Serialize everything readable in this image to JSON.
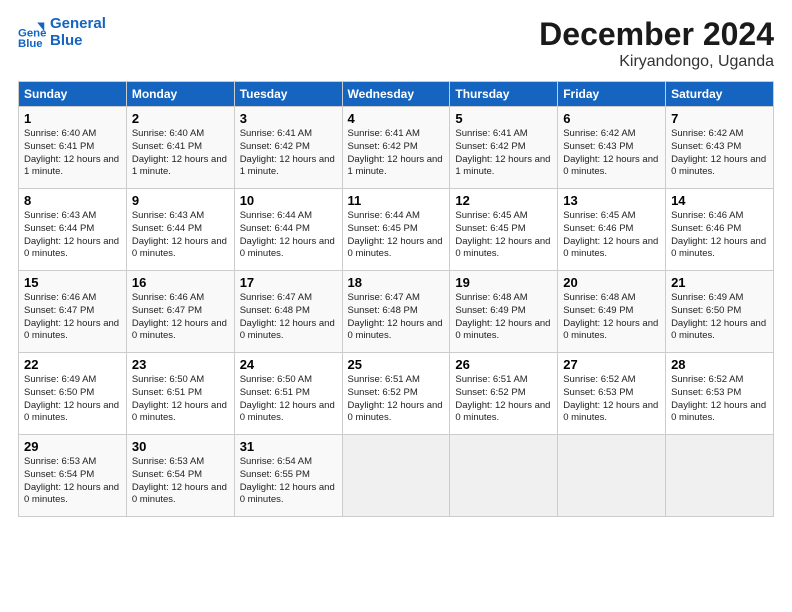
{
  "header": {
    "logo_line1": "General",
    "logo_line2": "Blue",
    "month": "December 2024",
    "location": "Kiryandongo, Uganda"
  },
  "days_of_week": [
    "Sunday",
    "Monday",
    "Tuesday",
    "Wednesday",
    "Thursday",
    "Friday",
    "Saturday"
  ],
  "weeks": [
    [
      {
        "day": "1",
        "sunrise": "6:40 AM",
        "sunset": "6:41 PM",
        "daylight": "12 hours and 1 minute."
      },
      {
        "day": "2",
        "sunrise": "6:40 AM",
        "sunset": "6:41 PM",
        "daylight": "12 hours and 1 minute."
      },
      {
        "day": "3",
        "sunrise": "6:41 AM",
        "sunset": "6:42 PM",
        "daylight": "12 hours and 1 minute."
      },
      {
        "day": "4",
        "sunrise": "6:41 AM",
        "sunset": "6:42 PM",
        "daylight": "12 hours and 1 minute."
      },
      {
        "day": "5",
        "sunrise": "6:41 AM",
        "sunset": "6:42 PM",
        "daylight": "12 hours and 1 minute."
      },
      {
        "day": "6",
        "sunrise": "6:42 AM",
        "sunset": "6:43 PM",
        "daylight": "12 hours and 0 minutes."
      },
      {
        "day": "7",
        "sunrise": "6:42 AM",
        "sunset": "6:43 PM",
        "daylight": "12 hours and 0 minutes."
      }
    ],
    [
      {
        "day": "8",
        "sunrise": "6:43 AM",
        "sunset": "6:44 PM",
        "daylight": "12 hours and 0 minutes."
      },
      {
        "day": "9",
        "sunrise": "6:43 AM",
        "sunset": "6:44 PM",
        "daylight": "12 hours and 0 minutes."
      },
      {
        "day": "10",
        "sunrise": "6:44 AM",
        "sunset": "6:44 PM",
        "daylight": "12 hours and 0 minutes."
      },
      {
        "day": "11",
        "sunrise": "6:44 AM",
        "sunset": "6:45 PM",
        "daylight": "12 hours and 0 minutes."
      },
      {
        "day": "12",
        "sunrise": "6:45 AM",
        "sunset": "6:45 PM",
        "daylight": "12 hours and 0 minutes."
      },
      {
        "day": "13",
        "sunrise": "6:45 AM",
        "sunset": "6:46 PM",
        "daylight": "12 hours and 0 minutes."
      },
      {
        "day": "14",
        "sunrise": "6:46 AM",
        "sunset": "6:46 PM",
        "daylight": "12 hours and 0 minutes."
      }
    ],
    [
      {
        "day": "15",
        "sunrise": "6:46 AM",
        "sunset": "6:47 PM",
        "daylight": "12 hours and 0 minutes."
      },
      {
        "day": "16",
        "sunrise": "6:46 AM",
        "sunset": "6:47 PM",
        "daylight": "12 hours and 0 minutes."
      },
      {
        "day": "17",
        "sunrise": "6:47 AM",
        "sunset": "6:48 PM",
        "daylight": "12 hours and 0 minutes."
      },
      {
        "day": "18",
        "sunrise": "6:47 AM",
        "sunset": "6:48 PM",
        "daylight": "12 hours and 0 minutes."
      },
      {
        "day": "19",
        "sunrise": "6:48 AM",
        "sunset": "6:49 PM",
        "daylight": "12 hours and 0 minutes."
      },
      {
        "day": "20",
        "sunrise": "6:48 AM",
        "sunset": "6:49 PM",
        "daylight": "12 hours and 0 minutes."
      },
      {
        "day": "21",
        "sunrise": "6:49 AM",
        "sunset": "6:50 PM",
        "daylight": "12 hours and 0 minutes."
      }
    ],
    [
      {
        "day": "22",
        "sunrise": "6:49 AM",
        "sunset": "6:50 PM",
        "daylight": "12 hours and 0 minutes."
      },
      {
        "day": "23",
        "sunrise": "6:50 AM",
        "sunset": "6:51 PM",
        "daylight": "12 hours and 0 minutes."
      },
      {
        "day": "24",
        "sunrise": "6:50 AM",
        "sunset": "6:51 PM",
        "daylight": "12 hours and 0 minutes."
      },
      {
        "day": "25",
        "sunrise": "6:51 AM",
        "sunset": "6:52 PM",
        "daylight": "12 hours and 0 minutes."
      },
      {
        "day": "26",
        "sunrise": "6:51 AM",
        "sunset": "6:52 PM",
        "daylight": "12 hours and 0 minutes."
      },
      {
        "day": "27",
        "sunrise": "6:52 AM",
        "sunset": "6:53 PM",
        "daylight": "12 hours and 0 minutes."
      },
      {
        "day": "28",
        "sunrise": "6:52 AM",
        "sunset": "6:53 PM",
        "daylight": "12 hours and 0 minutes."
      }
    ],
    [
      {
        "day": "29",
        "sunrise": "6:53 AM",
        "sunset": "6:54 PM",
        "daylight": "12 hours and 0 minutes."
      },
      {
        "day": "30",
        "sunrise": "6:53 AM",
        "sunset": "6:54 PM",
        "daylight": "12 hours and 0 minutes."
      },
      {
        "day": "31",
        "sunrise": "6:54 AM",
        "sunset": "6:55 PM",
        "daylight": "12 hours and 0 minutes."
      },
      null,
      null,
      null,
      null
    ]
  ]
}
